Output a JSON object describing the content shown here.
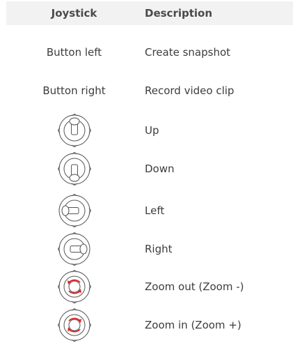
{
  "table": {
    "headers": {
      "joystick": "Joystick",
      "description": "Description"
    },
    "rows": [
      {
        "joystick": "Button left",
        "description": "Create snapshot"
      },
      {
        "joystick": "Button right",
        "description": "Record video clip"
      },
      {
        "joystick_icon": "joystick-up-icon",
        "description": "Up"
      },
      {
        "joystick_icon": "joystick-down-icon",
        "description": "Down"
      },
      {
        "joystick_icon": "joystick-left-icon",
        "description": "Left"
      },
      {
        "joystick_icon": "joystick-right-icon",
        "description": "Right"
      },
      {
        "joystick_icon": "joystick-rotate-ccw-icon",
        "description": "Zoom out (Zoom -)"
      },
      {
        "joystick_icon": "joystick-rotate-cw-icon",
        "description": "Zoom in (Zoom +)"
      }
    ]
  },
  "colors": {
    "header_bg": "#f2f2f2",
    "icon_stroke": "#555555",
    "arrow_red": "#e0262b"
  }
}
